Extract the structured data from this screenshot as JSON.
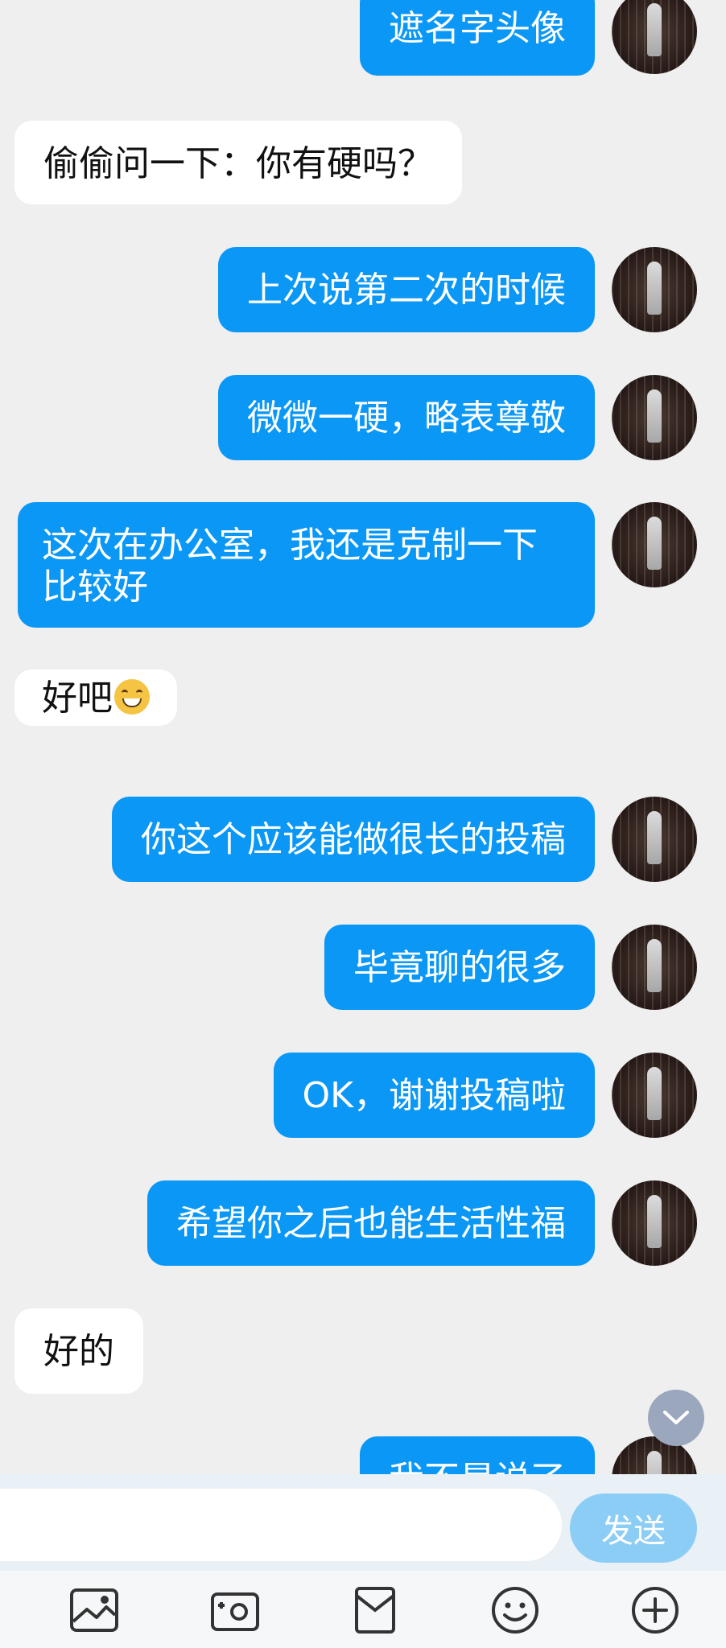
{
  "messages": [
    {
      "dir": "out",
      "text": "遮名字头像"
    },
    {
      "dir": "in",
      "text": "偷偷问一下：你有硬吗？"
    },
    {
      "dir": "out",
      "text": "上次说第二次的时候"
    },
    {
      "dir": "out",
      "text": "微微一硬，略表尊敬"
    },
    {
      "dir": "out",
      "text": "这次在办公室，我还是克制一下比较好"
    },
    {
      "dir": "in",
      "text": "好吧",
      "emoji": "grinning-face"
    },
    {
      "dir": "out",
      "text": "你这个应该能做很长的投稿"
    },
    {
      "dir": "out",
      "text": "毕竟聊的很多"
    },
    {
      "dir": "out",
      "text": "OK，谢谢投稿啦"
    },
    {
      "dir": "out",
      "text": "希望你之后也能生活性福"
    },
    {
      "dir": "in",
      "text": "好的"
    },
    {
      "dir": "out",
      "text": "我不是说了"
    }
  ],
  "input": {
    "value": "",
    "send_label": "发送"
  },
  "toolbar": [
    "image-icon",
    "camera-icon",
    "red-packet-icon",
    "emoji-icon",
    "plus-icon"
  ],
  "colors": {
    "outgoing_bubble": "#0a97f5",
    "incoming_bubble": "#ffffff",
    "background": "#efeff0",
    "send_button": "#8ccdf6"
  }
}
